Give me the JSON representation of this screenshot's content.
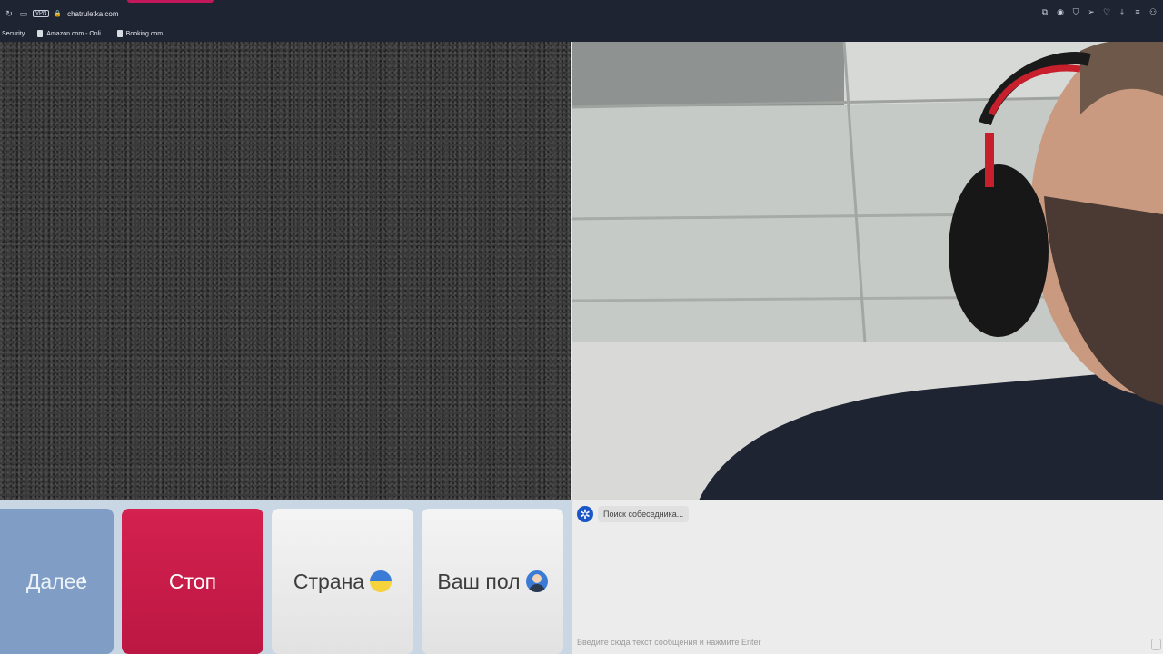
{
  "browser": {
    "url": "chatruletka.com",
    "vpn_label": "VPN",
    "bookmarks": [
      "Security",
      "Amazon.com - Onli...",
      "Booking.com"
    ],
    "toolbar_icons": [
      "screenshot-icon",
      "camera-icon",
      "shield-icon",
      "send-icon",
      "heart-icon",
      "download-icon",
      "menu-icon",
      "account-icon"
    ]
  },
  "controls": {
    "next_label": "Далее",
    "stop_label": "Стоп",
    "country_label": "Страна",
    "gender_label": "Ваш пол",
    "stop_color": "#c8193f",
    "next_color": "#7f9dc5"
  },
  "chat": {
    "status": "Поиск собеседника...",
    "input_placeholder": "Введите сюда текст сообщения и нажмите Enter"
  }
}
